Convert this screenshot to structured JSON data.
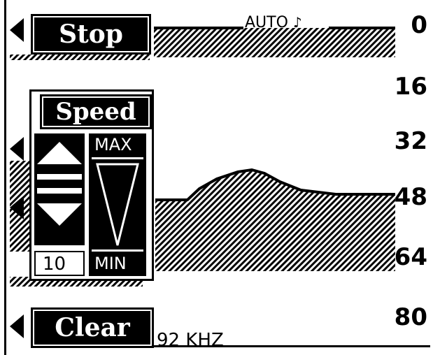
{
  "buttons": {
    "stop_label": "Stop",
    "speed_label": "Speed",
    "clear_label": "Clear"
  },
  "status": {
    "mode": "AUTO",
    "frequency": "92 KHZ"
  },
  "depth_scale": [
    "0",
    "16",
    "32",
    "48",
    "64",
    "80"
  ],
  "speed_control": {
    "max_label": "MAX",
    "min_label": "MIN",
    "value": "10"
  },
  "icons": {
    "stop_tab": "arrow-left-icon",
    "speed_up_tab": "arrow-left-icon",
    "speed_down_tab": "arrow-left-icon",
    "clear_tab": "arrow-left-icon",
    "speed_up": "triangle-up-icon",
    "speed_down": "triangle-down-icon",
    "speed_meter": "wedge-icon"
  },
  "colors": {
    "foreground": "#000000",
    "background": "#ffffff"
  }
}
